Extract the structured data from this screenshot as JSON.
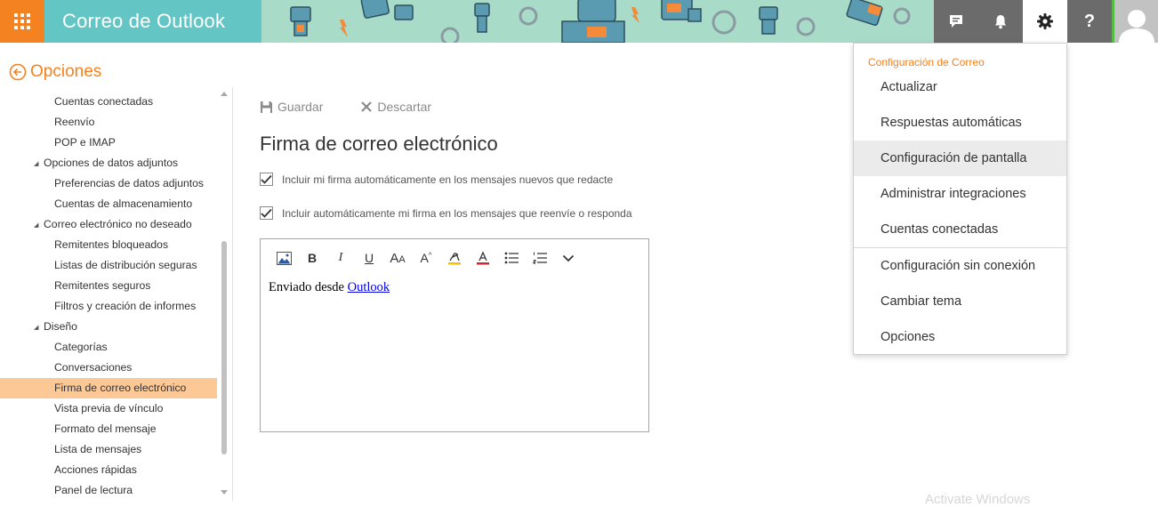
{
  "app": {
    "title": "Correo de Outlook"
  },
  "topbar": {
    "waffle_icon": "app-launcher-icon",
    "icons": [
      "chat-icon",
      "bell-icon",
      "gear-icon",
      "help-icon",
      "user-avatar-icon"
    ],
    "colors": {
      "waffle": "#f58220",
      "brand": "#64c6c4",
      "banner": "#a8dcc8",
      "icon_bg": "#6b6b6b"
    }
  },
  "options": {
    "back_icon": "back-arrow-icon",
    "title": "Opciones"
  },
  "nav": {
    "items": [
      {
        "label": "Cuentas conectadas",
        "level": 2
      },
      {
        "label": "Reenvío",
        "level": 2
      },
      {
        "label": "POP e IMAP",
        "level": 2
      },
      {
        "label": "Opciones de datos adjuntos",
        "level": 1
      },
      {
        "label": "Preferencias de datos adjuntos",
        "level": 2
      },
      {
        "label": "Cuentas de almacenamiento",
        "level": 2
      },
      {
        "label": "Correo electrónico no deseado",
        "level": 1
      },
      {
        "label": "Remitentes bloqueados",
        "level": 2
      },
      {
        "label": "Listas de distribución seguras",
        "level": 2
      },
      {
        "label": "Remitentes seguros",
        "level": 2
      },
      {
        "label": "Filtros y creación de informes",
        "level": 2
      },
      {
        "label": "Diseño",
        "level": 1
      },
      {
        "label": "Categorías",
        "level": 2
      },
      {
        "label": "Conversaciones",
        "level": 2
      },
      {
        "label": "Firma de correo electrónico",
        "level": 2,
        "selected": true
      },
      {
        "label": "Vista previa de vínculo",
        "level": 2
      },
      {
        "label": "Formato del mensaje",
        "level": 2
      },
      {
        "label": "Lista de mensajes",
        "level": 2
      },
      {
        "label": "Acciones rápidas",
        "level": 2
      },
      {
        "label": "Panel de lectura",
        "level": 2
      }
    ],
    "selected_color": "#fcc896"
  },
  "toolbar": {
    "save_label": "Guardar",
    "discard_label": "Descartar"
  },
  "main": {
    "title": "Firma de correo electrónico",
    "check_new": "Incluir mi firma automáticamente en los mensajes nuevos que redacte",
    "check_reply": "Incluir automáticamente mi firma en los mensajes que reenvíe o responda",
    "check_new_checked": true,
    "check_reply_checked": true
  },
  "editor": {
    "tools": [
      "insert-image-icon",
      "bold-icon",
      "italic-icon",
      "underline-icon",
      "font-size-icon",
      "grow-font-icon",
      "highlight-icon",
      "font-color-icon",
      "bullets-icon",
      "numbering-icon",
      "more-icon"
    ],
    "body_prefix": "Enviado desde ",
    "body_link": "Outlook"
  },
  "menu": {
    "header": "Configuración de Correo",
    "items": [
      "Actualizar",
      "Respuestas automáticas",
      "Configuración de pantalla",
      "Administrar integraciones",
      "Cuentas conectadas",
      "Configuración sin conexión",
      "Cambiar tema",
      "Opciones"
    ],
    "hovered": "Configuración de pantalla"
  },
  "watermark": "Activate Windows"
}
